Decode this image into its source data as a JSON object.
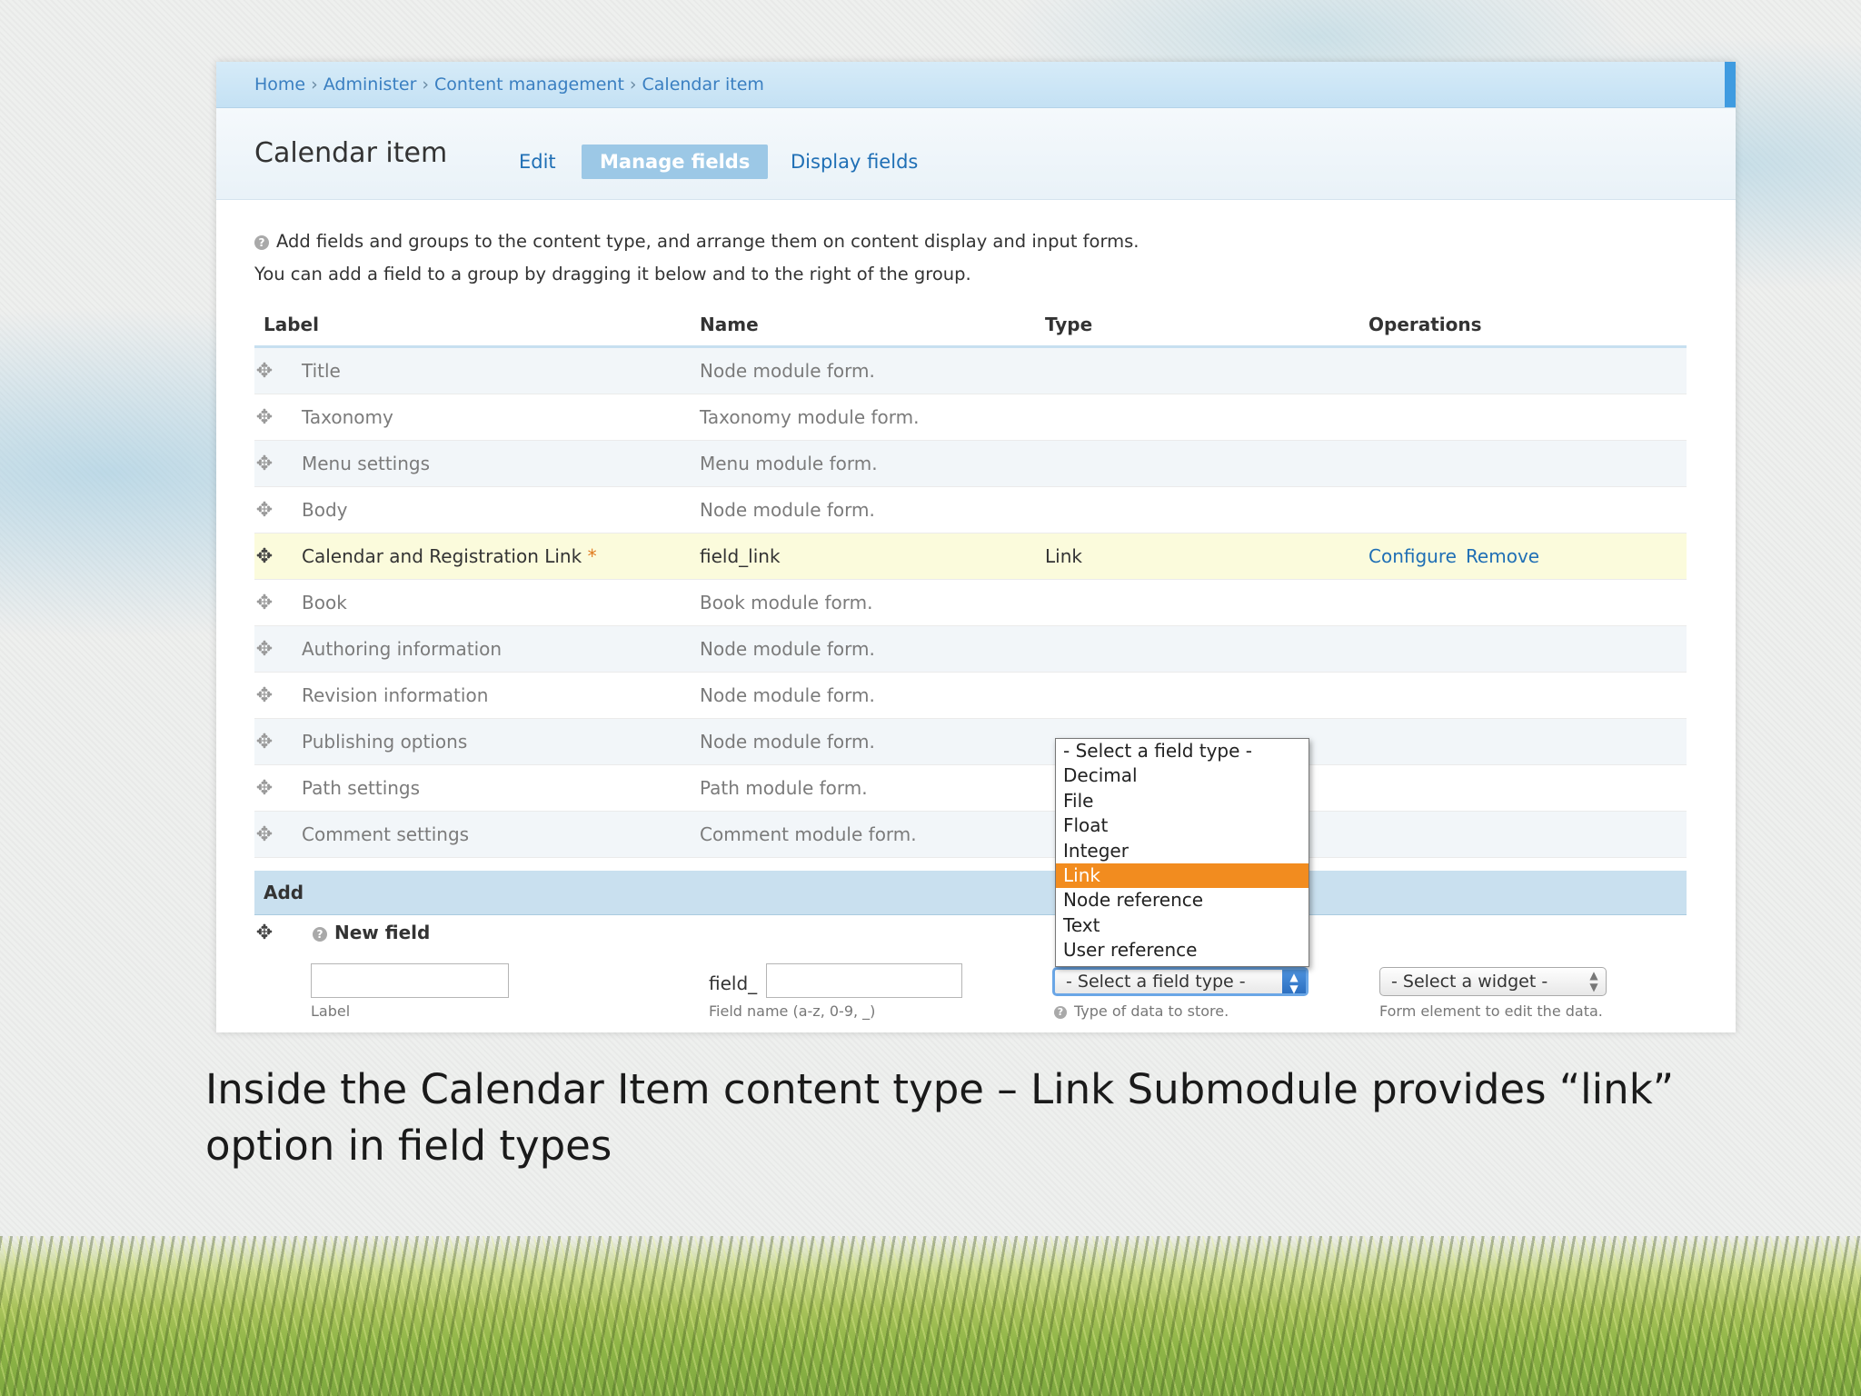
{
  "breadcrumb": [
    "Home",
    "Administer",
    "Content management",
    "Calendar item"
  ],
  "page": {
    "title": "Calendar item"
  },
  "tabs": {
    "edit": "Edit",
    "manage_fields": "Manage fields",
    "display_fields": "Display fields"
  },
  "help": {
    "line1": "Add fields and groups to the content type, and arrange them on content display and input forms.",
    "line2": "You can add a field to a group by dragging it below and to the right of the group."
  },
  "table": {
    "headers": {
      "label": "Label",
      "name": "Name",
      "type": "Type",
      "operations": "Operations"
    },
    "rows": [
      {
        "label": "Title",
        "name": "Node module form.",
        "type": ""
      },
      {
        "label": "Taxonomy",
        "name": "Taxonomy module form.",
        "type": ""
      },
      {
        "label": "Menu settings",
        "name": "Menu module form.",
        "type": ""
      },
      {
        "label": "Body",
        "name": "Node module form.",
        "type": ""
      },
      {
        "label": "Calendar and Registration Link",
        "required_mark": "*",
        "name": "field_link",
        "type": "Link",
        "configure": "Configure",
        "remove": "Remove"
      },
      {
        "label": "Book",
        "name": "Book module form.",
        "type": ""
      },
      {
        "label": "Authoring information",
        "name": "Node module form.",
        "type": ""
      },
      {
        "label": "Revision information",
        "name": "Node module form.",
        "type": ""
      },
      {
        "label": "Publishing options",
        "name": "Node module form.",
        "type": ""
      },
      {
        "label": "Path settings",
        "name": "Path module form.",
        "type": ""
      },
      {
        "label": "Comment settings",
        "name": "Comment module form.",
        "type": ""
      }
    ]
  },
  "add": {
    "title": "Add",
    "new_field": "New field",
    "label_desc": "Label",
    "field_prefix": "field_",
    "field_name_desc": "Field name (a-z, 0-9, _)",
    "type_select": "- Select a field type -",
    "type_desc": "Type of data to store.",
    "widget_select": "- Select a widget -",
    "widget_desc": "Form element to edit the data."
  },
  "dropdown": {
    "options": [
      "- Select a field type -",
      "Decimal",
      "File",
      "Float",
      "Integer",
      "Link",
      "Node reference",
      "Text",
      "User reference"
    ],
    "selected": "Link"
  },
  "caption": "Inside the Calendar Item content type – Link Submodule provides “link” option in field types",
  "colors": {
    "link": "#1f6fb5",
    "highlight_row": "#fbfbdc",
    "dropdown_selected": "#f28c1f",
    "accent": "#3f9be0"
  }
}
